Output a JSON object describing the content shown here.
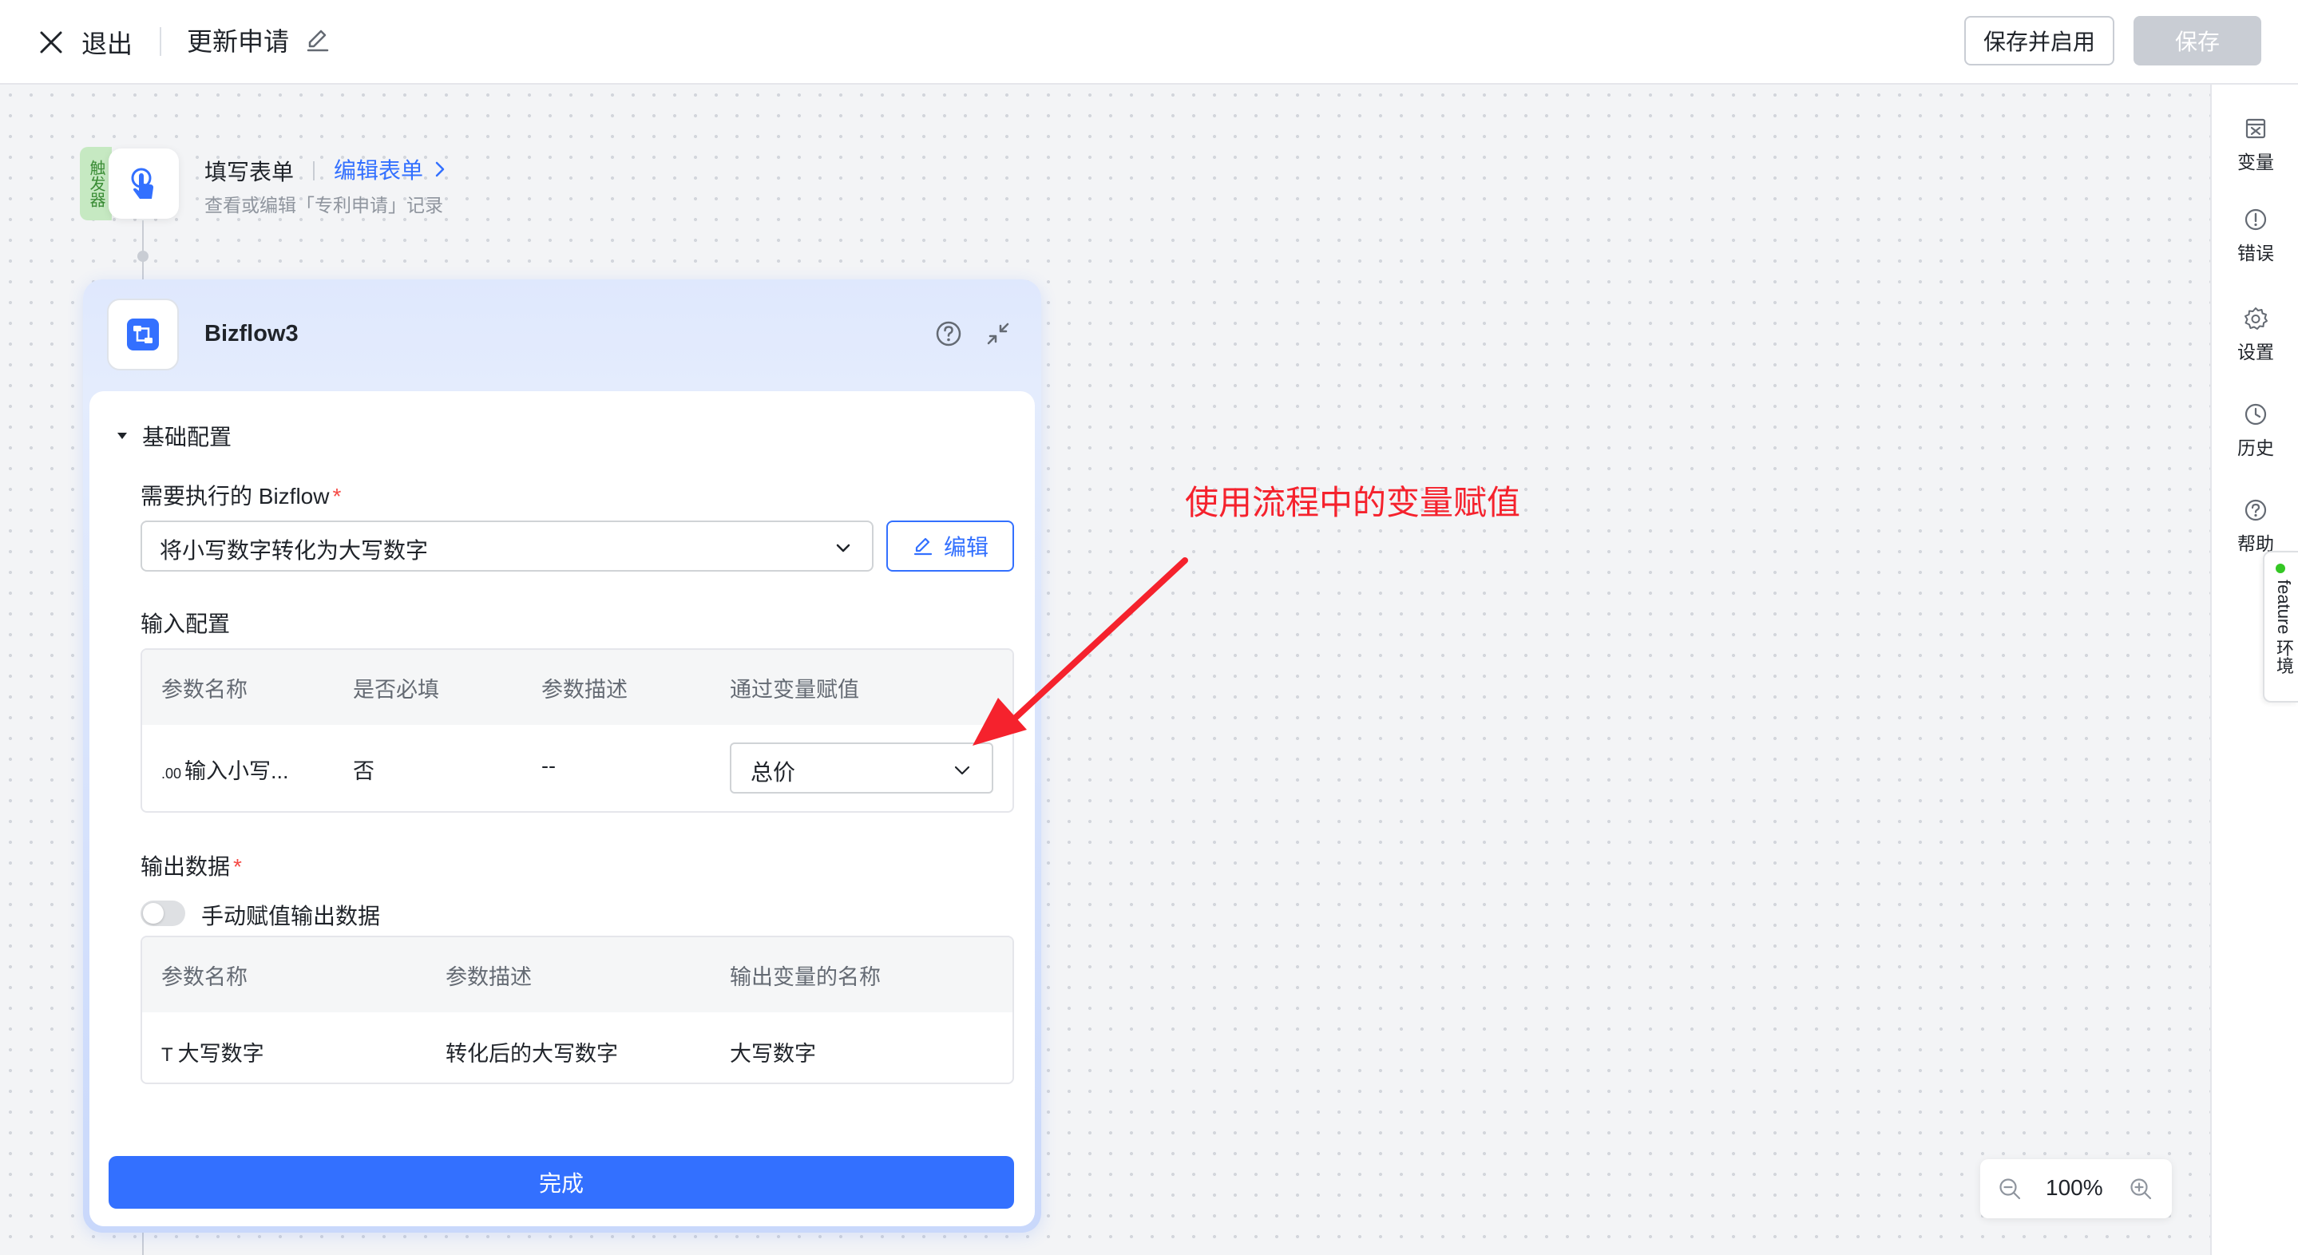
{
  "topbar": {
    "exit_label": "退出",
    "title": "更新申请",
    "save_enable_label": "保存并启用",
    "save_label": "保存"
  },
  "trigger": {
    "badge": "触发器",
    "title": "填写表单",
    "edit_link": "编辑表单",
    "description": "查看或编辑「专利申请」记录"
  },
  "node": {
    "title": "Bizflow3",
    "basic_section": "基础配置",
    "flow_label": "需要执行的 Bizflow",
    "flow_value": "将小写数字转化为大写数字",
    "edit_label": "编辑",
    "input_section": "输入配置",
    "input_table": {
      "headers": [
        "参数名称",
        "是否必填",
        "参数描述",
        "通过变量赋值"
      ],
      "row": {
        "type_icon": ".00",
        "name": "输入小写...",
        "required": "否",
        "description": "--",
        "variable": "总价"
      }
    },
    "output_section": "输出数据",
    "manual_toggle_label": "手动赋值输出数据",
    "output_table": {
      "headers": [
        "参数名称",
        "参数描述",
        "输出变量的名称"
      ],
      "row": {
        "type_icon": "T",
        "name": "大写数字",
        "description": "转化后的大写数字",
        "variable_name": "大写数字"
      }
    },
    "done_label": "完成"
  },
  "annotation": "使用流程中的变量赋值",
  "zoom": {
    "value": "100%"
  },
  "right_sidebar": {
    "items": [
      "变量",
      "错误",
      "设置",
      "历史",
      "帮助"
    ],
    "feature_tab": "feature 环境"
  },
  "colors": {
    "accent": "#3370ff",
    "annotation": "#f5222d",
    "required": "#f54a45"
  }
}
